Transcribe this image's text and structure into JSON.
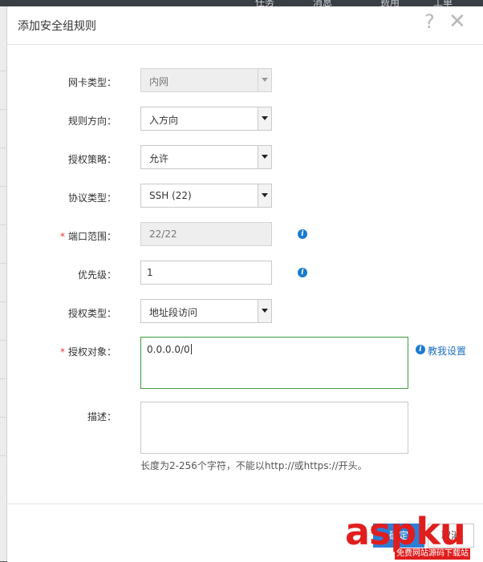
{
  "background_bar": {
    "items": [
      "任务",
      "消息",
      "费用",
      "工单"
    ]
  },
  "dialog": {
    "title": "添加安全组规则",
    "help_icon": "?",
    "close_icon": "✕"
  },
  "form": {
    "nic_type": {
      "label": "网卡类型：",
      "value": "内网",
      "disabled": true
    },
    "direction": {
      "label": "规则方向：",
      "value": "入方向"
    },
    "policy": {
      "label": "授权策略：",
      "value": "允许"
    },
    "protocol": {
      "label": "协议类型：",
      "value": "SSH (22)"
    },
    "port_range": {
      "label": "端口范围：",
      "required": "*",
      "value": "22/22",
      "disabled": true
    },
    "priority": {
      "label": "优先级：",
      "value": "1"
    },
    "auth_type": {
      "label": "授权类型：",
      "value": "地址段访问"
    },
    "auth_object": {
      "label": "授权对象：",
      "required": "*",
      "value": "0.0.0.0/0",
      "help_link": "教我设置"
    },
    "description": {
      "label": "描述：",
      "value": "",
      "hint": "长度为2-256个字符，不能以http://或https://开头。"
    }
  },
  "footer": {
    "ok_label": "确定",
    "cancel_label": "取消"
  },
  "watermark": {
    "main": "aspku",
    "sub": "免费网站源码下载站"
  },
  "colors": {
    "primary": "#2c7fd6",
    "focus_border": "#3d9c3d",
    "required": "#e4393c",
    "watermark": "#e01e1e"
  }
}
